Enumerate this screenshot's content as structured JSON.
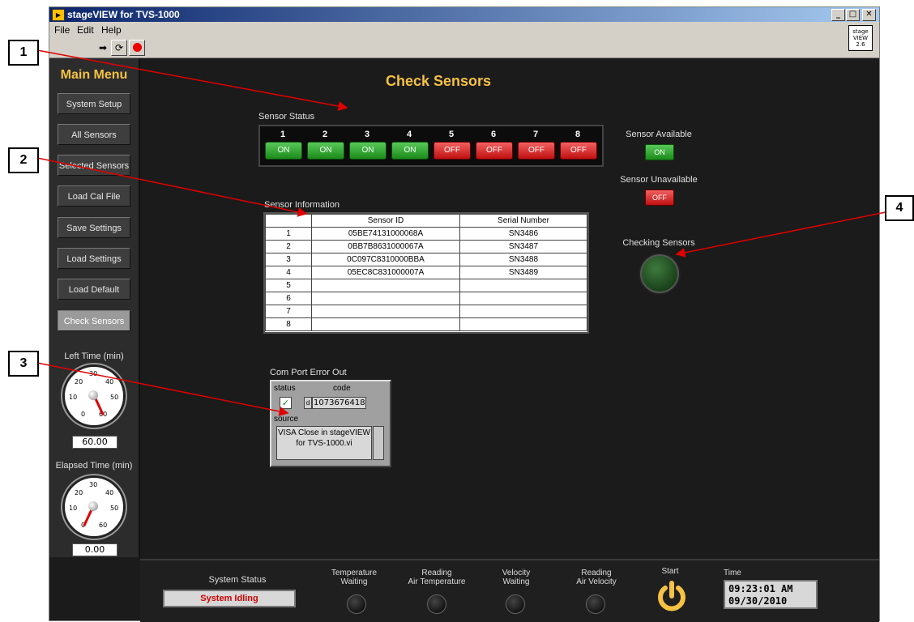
{
  "window": {
    "title": "stageVIEW for TVS-1000",
    "version_logo": "stage VIEW 2.6"
  },
  "menu": {
    "file": "File",
    "edit": "Edit",
    "help": "Help"
  },
  "sidebar": {
    "title": "Main Menu",
    "items": [
      {
        "label": "System Setup"
      },
      {
        "label": "All Sensors"
      },
      {
        "label": "Selected  Sensors"
      },
      {
        "label": "Load Cal File"
      },
      {
        "label": "Save Settings"
      },
      {
        "label": "Load Settings"
      },
      {
        "label": "Load Default"
      },
      {
        "label": "Check Sensors"
      }
    ],
    "left_time": {
      "label": "Left Time (min)",
      "ticks": [
        "0",
        "10",
        "20",
        "30",
        "40",
        "50",
        "60"
      ],
      "value": "60.00"
    },
    "elapsed_time": {
      "label": "Elapsed Time (min)",
      "ticks": [
        "0",
        "10",
        "20",
        "30",
        "40",
        "50",
        "60"
      ],
      "value": "0.00"
    }
  },
  "main": {
    "title": "Check Sensors",
    "sensor_status": {
      "label": "Sensor Status",
      "sensors": [
        {
          "num": "1",
          "state": "ON"
        },
        {
          "num": "2",
          "state": "ON"
        },
        {
          "num": "3",
          "state": "ON"
        },
        {
          "num": "4",
          "state": "ON"
        },
        {
          "num": "5",
          "state": "OFF"
        },
        {
          "num": "6",
          "state": "OFF"
        },
        {
          "num": "7",
          "state": "OFF"
        },
        {
          "num": "8",
          "state": "OFF"
        }
      ]
    },
    "legend": {
      "available": "Sensor Available",
      "available_state": "ON",
      "unavailable": "Sensor Unavailable",
      "unavailable_state": "OFF"
    },
    "checking": {
      "label": "Checking Sensors"
    },
    "sensor_info": {
      "label": "Sensor Information",
      "columns": [
        "",
        "Sensor ID",
        "Serial Number"
      ],
      "rows": [
        [
          "1",
          "05BE74131000068A",
          "SN3486"
        ],
        [
          "2",
          "0BB7B8631000067A",
          "SN3487"
        ],
        [
          "3",
          "0C097C8310000BBA",
          "SN3488"
        ],
        [
          "4",
          "05EC8C831000007A",
          "SN3489"
        ],
        [
          "5",
          "",
          ""
        ],
        [
          "6",
          "",
          ""
        ],
        [
          "7",
          "",
          ""
        ],
        [
          "8",
          "",
          ""
        ]
      ]
    },
    "com_error": {
      "label": "Com Port Error Out",
      "status_label": "status",
      "code_label": "code",
      "code_prefix": "d",
      "code_value": "1073676418",
      "source_label": "source",
      "source_text": "VISA Close in stageVIEW for TVS-1000.vi"
    }
  },
  "bottom": {
    "system_status_label": "System Status",
    "system_status_value": "System Idling",
    "indicators": [
      {
        "line1": "Temperature",
        "line2": "Waiting"
      },
      {
        "line1": "Reading",
        "line2": "Air Temperature"
      },
      {
        "line1": "Velocity",
        "line2": "Waiting"
      },
      {
        "line1": "Reading",
        "line2": "Air Velocity"
      }
    ],
    "start_label": "Start",
    "time_label": "Time",
    "time_value": "09:23:01 AM",
    "date_value": "09/30/2010"
  },
  "callouts": [
    "1",
    "2",
    "3",
    "4"
  ],
  "colors": {
    "accent": "#f5c242",
    "on": "#2aa52a",
    "off": "#d42020",
    "annotation": "#e00000"
  }
}
